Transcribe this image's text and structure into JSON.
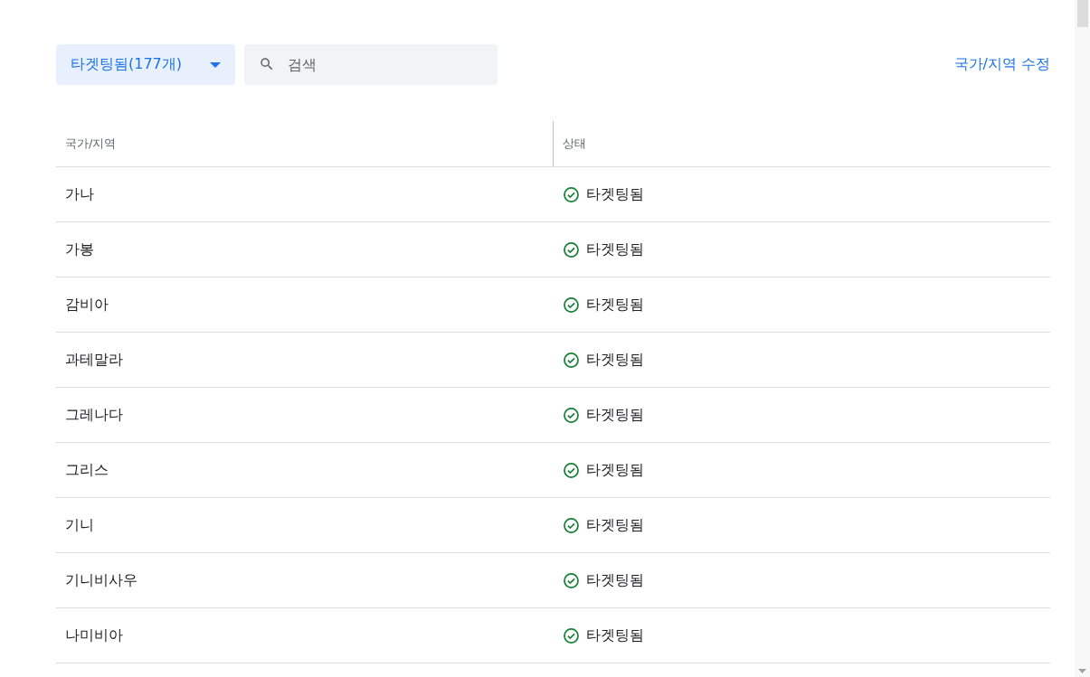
{
  "filter_dropdown": {
    "label": "타겟팅됨(177개)"
  },
  "search": {
    "placeholder": "검색"
  },
  "edit_link": "국가/지역 수정",
  "table": {
    "columns": [
      "국가/지역",
      "상태"
    ],
    "rows": [
      {
        "country": "가나",
        "status": "타겟팅됨"
      },
      {
        "country": "가봉",
        "status": "타겟팅됨"
      },
      {
        "country": "감비아",
        "status": "타겟팅됨"
      },
      {
        "country": "과테말라",
        "status": "타겟팅됨"
      },
      {
        "country": "그레나다",
        "status": "타겟팅됨"
      },
      {
        "country": "그리스",
        "status": "타겟팅됨"
      },
      {
        "country": "기니",
        "status": "타겟팅됨"
      },
      {
        "country": "기니비사우",
        "status": "타겟팅됨"
      },
      {
        "country": "나미비아",
        "status": "타겟팅됨"
      }
    ]
  }
}
